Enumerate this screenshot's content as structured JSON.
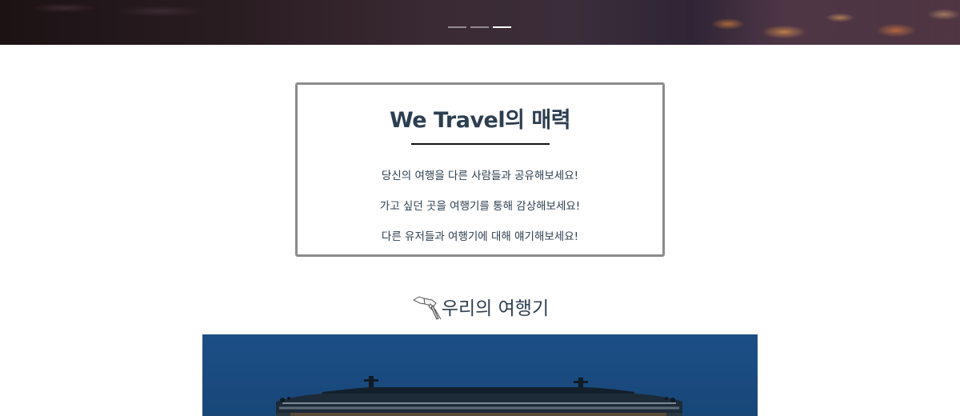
{
  "hero": {
    "slides": [
      {
        "active": false
      },
      {
        "active": false
      },
      {
        "active": true
      }
    ]
  },
  "intro": {
    "title": "We Travel의 매력",
    "lines": [
      "당신의 여행을 다른 사람들과 공유해보세요!",
      "가고 싶던 곳을 여행기를 통해 감상해보세요!",
      "다른 유저들과 여행기에 대해 얘기해보세요!"
    ]
  },
  "section": {
    "title": "우리의 여행기",
    "icon": "quill-hand-icon"
  },
  "photo": {
    "subject": "palace-roof-photo"
  },
  "colors": {
    "text": "#2c3e50",
    "border": "#8c8c8c",
    "sky": "#1d4f86"
  }
}
